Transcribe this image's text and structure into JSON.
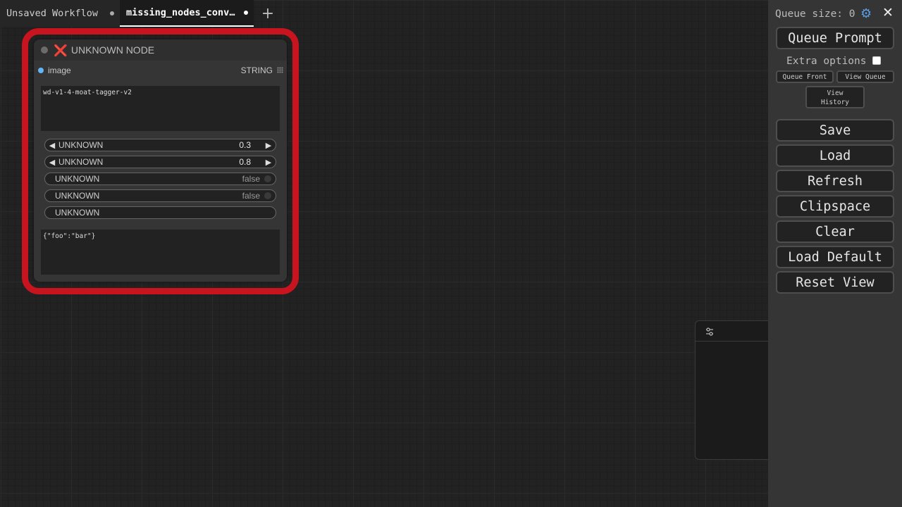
{
  "tabs": [
    {
      "label": "Unsaved Workflow"
    },
    {
      "label": "missing_nodes_converted_widget"
    }
  ],
  "tab_add_label": "+",
  "node": {
    "title_icon": "❌",
    "title": "UNKNOWN NODE",
    "input_slot": "image",
    "output_slot": "STRING",
    "text_value": "wd-v1-4-moat-tagger-v2",
    "widgets": [
      {
        "label": "UNKNOWN",
        "value": "0.3"
      },
      {
        "label": "UNKNOWN",
        "value": "0.8"
      },
      {
        "label": "UNKNOWN",
        "value": "false"
      },
      {
        "label": "UNKNOWN",
        "value": "false"
      },
      {
        "label": "UNKNOWN"
      }
    ],
    "text_value_2": "{\"foo\":\"bar\"}"
  },
  "menu": {
    "queue_size": "Queue size: 0",
    "queue_prompt": "Queue Prompt",
    "extra_options": "Extra options",
    "queue_front": "Queue Front",
    "view_queue": "View Queue",
    "view_history_1": "View",
    "view_history_2": "History",
    "buttons": [
      "Save",
      "Load",
      "Refresh",
      "Clipspace",
      "Clear",
      "Load Default",
      "Reset View"
    ]
  },
  "colors": {
    "highlight": "#c8141e",
    "accent": "#5aa0e6",
    "background": "#222222"
  }
}
